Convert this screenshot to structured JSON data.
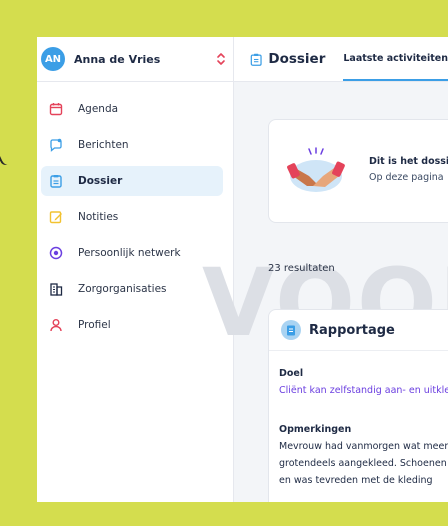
{
  "user": {
    "initials": "AN",
    "name": "Anna de Vries"
  },
  "sidebar": {
    "items": [
      {
        "label": "Agenda",
        "icon": "calendar-icon",
        "active": false
      },
      {
        "label": "Berichten",
        "icon": "message-icon",
        "active": false
      },
      {
        "label": "Dossier",
        "icon": "clipboard-icon",
        "active": true
      },
      {
        "label": "Notities",
        "icon": "note-icon",
        "active": false
      },
      {
        "label": "Persoonlijk netwerk",
        "icon": "network-icon",
        "active": false
      },
      {
        "label": "Zorgorganisaties",
        "icon": "building-icon",
        "active": false
      },
      {
        "label": "Profiel",
        "icon": "person-icon",
        "active": false
      }
    ]
  },
  "header": {
    "title": "Dossier",
    "tab": "Laatste activiteiten"
  },
  "watermark": "VOORBEELD",
  "info": {
    "title": "Dit is het dossier",
    "subtitle": "Op deze pagina"
  },
  "results": "23 resultaten",
  "report": {
    "title": "Rapportage",
    "goal_label": "Doel",
    "goal_text": "Cliënt kan zelfstandig aan- en uitkleden",
    "remarks_label": "Opmerkingen",
    "remarks_lines": [
      "Mevrouw had vanmorgen wat meer energie",
      "grotendeels aangekleed. Schoenen",
      "en was tevreden met de kleding"
    ]
  },
  "colors": {
    "frame": "#d4dd4e",
    "accent": "#3b9ee6",
    "active_bg": "#e6f2fb",
    "link": "#6b3fe0",
    "icon_red": "#e4435a",
    "icon_blue": "#3b9ee6",
    "icon_yellow": "#f2c230",
    "icon_purple": "#6b3fe0",
    "icon_dark": "#1e2a44"
  }
}
